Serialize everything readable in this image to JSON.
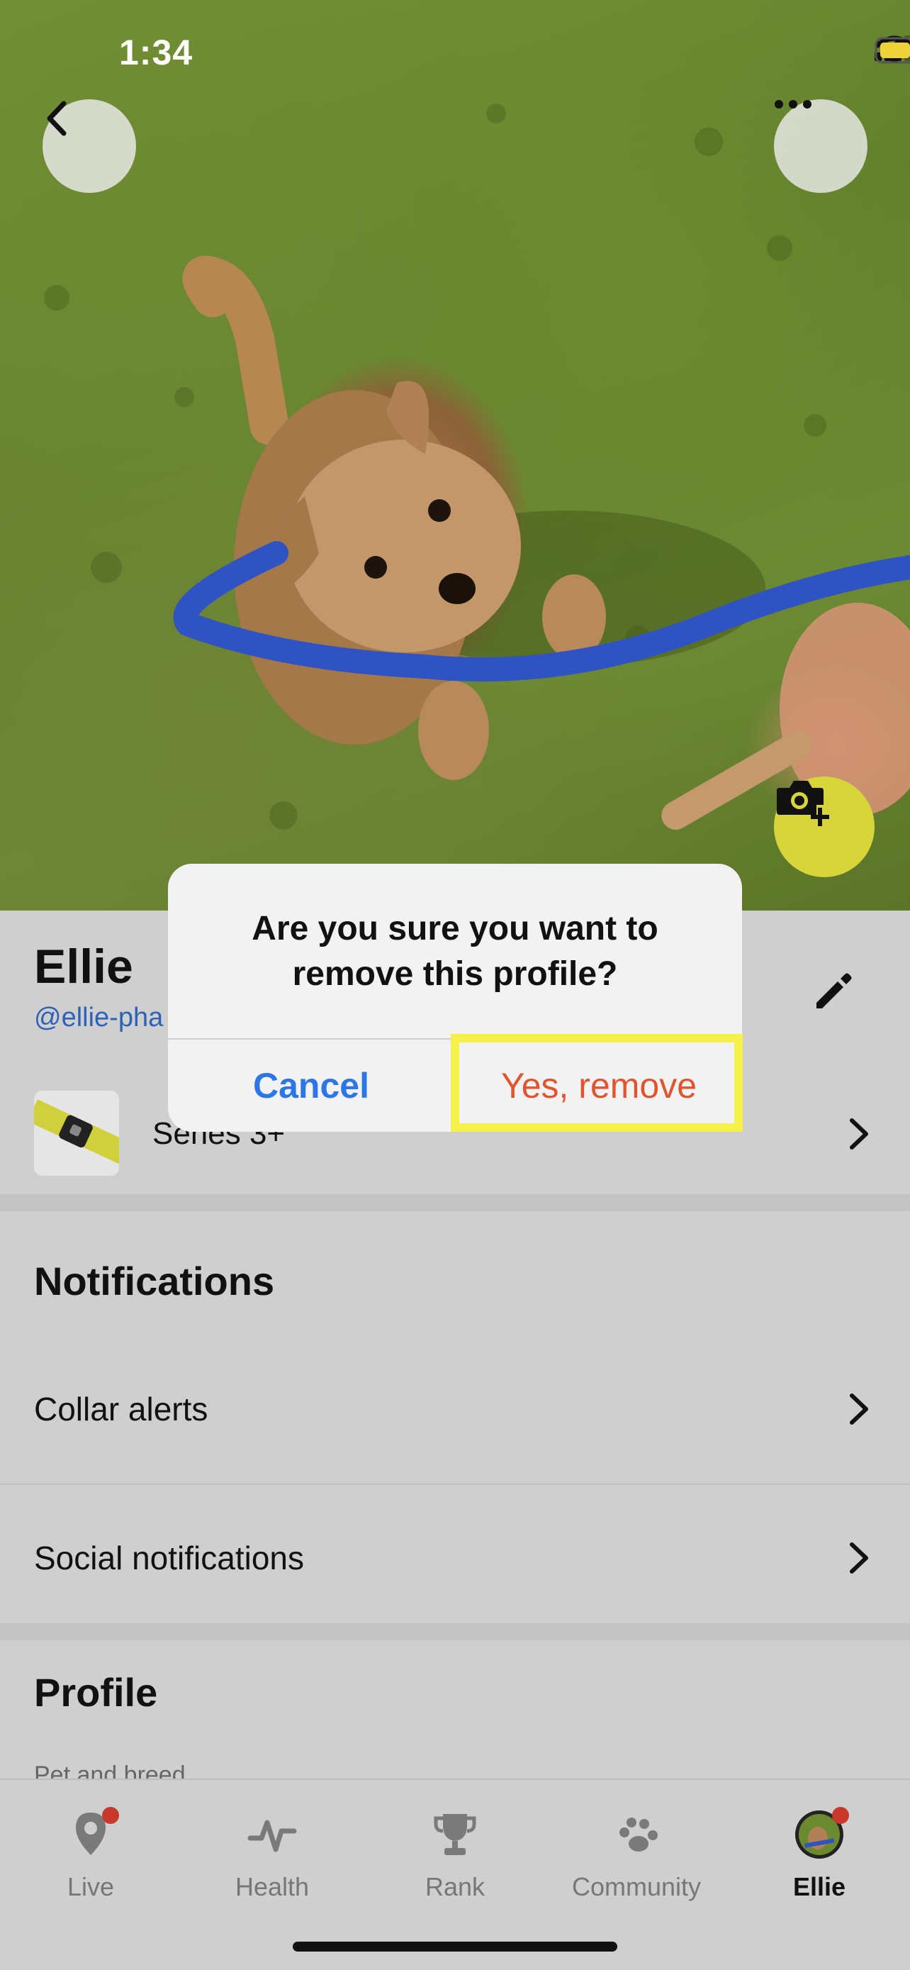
{
  "status_bar": {
    "time": "1:34"
  },
  "pet": {
    "name": "Ellie",
    "handle": "@ellie-pha"
  },
  "collar": {
    "label": "Series 3+"
  },
  "sections": {
    "notifications": {
      "title": "Notifications",
      "items": [
        {
          "label": "Collar alerts"
        },
        {
          "label": "Social notifications"
        }
      ]
    },
    "profile": {
      "title": "Profile",
      "sub_label": "Pet and breed"
    }
  },
  "alert": {
    "title": "Are you sure you want to remove this profile?",
    "cancel_label": "Cancel",
    "confirm_label": "Yes, remove"
  },
  "tabs": [
    {
      "label": "Live",
      "icon": "location-pin-icon",
      "badge": true
    },
    {
      "label": "Health",
      "icon": "pulse-icon",
      "badge": false
    },
    {
      "label": "Rank",
      "icon": "trophy-icon",
      "badge": false
    },
    {
      "label": "Community",
      "icon": "paw-icon",
      "badge": false
    },
    {
      "label": "Ellie",
      "icon": "pet-avatar",
      "badge": true,
      "active": true
    }
  ],
  "colors": {
    "accent_blue": "#2d76e6",
    "destructive": "#e0552d",
    "camera_button": "#d8d53a",
    "highlight": "#f6f14a",
    "badge": "#c8392b"
  }
}
